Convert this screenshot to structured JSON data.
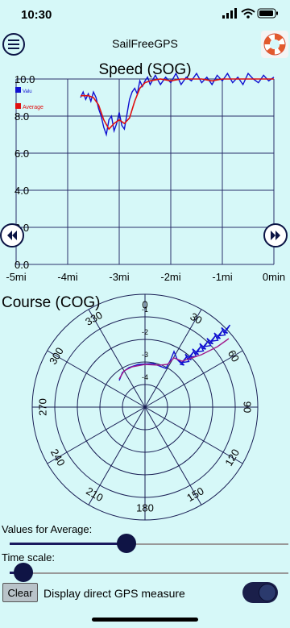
{
  "status_bar": {
    "time": "10:30"
  },
  "header": {
    "title": "SailFreeGPS"
  },
  "speed_chart": {
    "title": "Speed (SOG)",
    "legend": {
      "value_label": "Valu",
      "average_label": "Average"
    },
    "chart_data": {
      "type": "line",
      "title": "Speed (SOG)",
      "x_tick_labels": [
        "-5mi",
        "-4mi",
        "-3mi",
        "-2mi",
        "-1mi",
        "0min"
      ],
      "y_tick_labels": [
        "0.0",
        "2.0",
        "4.0",
        "6.0",
        "8.0",
        "10.0"
      ],
      "xlim": [
        -5,
        0
      ],
      "ylim": [
        0,
        10
      ],
      "series": [
        {
          "name": "Valu",
          "color": "#1010d0",
          "x": [
            -3.75,
            -3.7,
            -3.65,
            -3.6,
            -3.55,
            -3.5,
            -3.45,
            -3.4,
            -3.35,
            -3.3,
            -3.25,
            -3.2,
            -3.15,
            -3.1,
            -3.05,
            -3.0,
            -2.95,
            -2.9,
            -2.85,
            -2.8,
            -2.75,
            -2.7,
            -2.65,
            -2.6,
            -2.55,
            -2.5,
            -2.45,
            -2.4,
            -2.3,
            -2.2,
            -2.1,
            -2.0,
            -1.9,
            -1.8,
            -1.7,
            -1.6,
            -1.5,
            -1.4,
            -1.3,
            -1.2,
            -1.1,
            -1.0,
            -0.9,
            -0.8,
            -0.7,
            -0.6,
            -0.5,
            -0.4,
            -0.3,
            -0.2,
            -0.1,
            0.0
          ],
          "values": [
            9.0,
            9.3,
            8.9,
            9.2,
            8.8,
            9.3,
            9.0,
            8.4,
            8.0,
            7.4,
            7.0,
            7.8,
            8.0,
            7.2,
            7.6,
            8.2,
            7.5,
            7.3,
            8.1,
            8.9,
            9.3,
            9.5,
            9.2,
            9.9,
            9.6,
            9.9,
            10.1,
            9.7,
            10.2,
            9.7,
            10.1,
            9.8,
            10.3,
            9.7,
            10.1,
            9.9,
            10.3,
            9.8,
            10.1,
            9.7,
            10.2,
            9.9,
            10.3,
            9.8,
            10.1,
            9.7,
            10.3,
            10.0,
            9.8,
            10.2,
            9.9,
            10.1
          ]
        },
        {
          "name": "Average",
          "color": "#e01010",
          "x": [
            -3.75,
            -3.6,
            -3.5,
            -3.4,
            -3.3,
            -3.2,
            -3.1,
            -3.0,
            -2.9,
            -2.8,
            -2.7,
            -2.6,
            -2.5,
            -2.4,
            -2.2,
            -2.0,
            -1.8,
            -1.6,
            -1.4,
            -1.2,
            -1.0,
            -0.8,
            -0.6,
            -0.4,
            -0.2,
            0.0
          ],
          "values": [
            9.1,
            9.1,
            9.0,
            8.6,
            7.8,
            7.3,
            7.6,
            7.8,
            7.6,
            7.9,
            8.8,
            9.5,
            9.8,
            9.9,
            10.0,
            9.9,
            10.0,
            10.0,
            10.0,
            9.9,
            10.0,
            10.0,
            10.0,
            10.0,
            10.0,
            10.0
          ]
        }
      ],
      "grid": true
    }
  },
  "course_chart": {
    "title": "Course (COG)",
    "angle_labels": [
      "0",
      "30",
      "60",
      "90",
      "120",
      "150",
      "180",
      "210",
      "240",
      "270",
      "300",
      "330"
    ],
    "radial_labels": [
      "-1",
      "-2",
      "-3",
      "-4"
    ]
  },
  "controls": {
    "average_label": "Values for Average:",
    "average_value": 0.42,
    "timescale_label": "Time scale:",
    "timescale_value": 0.05,
    "clear_label": "Clear",
    "gps_toggle_label": "Display direct GPS measure",
    "gps_toggle_on": true
  },
  "icons": {
    "menu": "hamburger-menu-icon",
    "lifebuoy": "lifebuoy-icon",
    "rewind": "rewind-icon",
    "forward": "fast-forward-icon"
  }
}
